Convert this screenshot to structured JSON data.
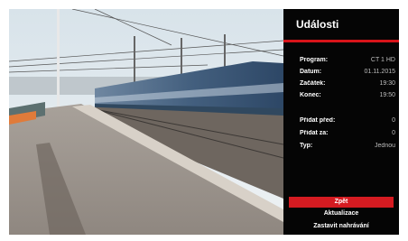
{
  "panel": {
    "title": "Události",
    "fields": [
      {
        "label": "Program:",
        "value": "CT 1 HD"
      },
      {
        "label": "Datum:",
        "value": "01.11.2015"
      },
      {
        "label": "Začátek:",
        "value": "19:30"
      },
      {
        "label": "Konec:",
        "value": "19:50"
      },
      {
        "label": "Přidat před:",
        "value": "0"
      },
      {
        "label": "Přidat za:",
        "value": "0"
      },
      {
        "label": "Typ:",
        "value": "Jednou"
      }
    ],
    "buttons": {
      "back": "Zpět",
      "refresh": "Aktualizace",
      "stop": "Zastavit nahrávání"
    },
    "accent_color": "#d51b21"
  }
}
